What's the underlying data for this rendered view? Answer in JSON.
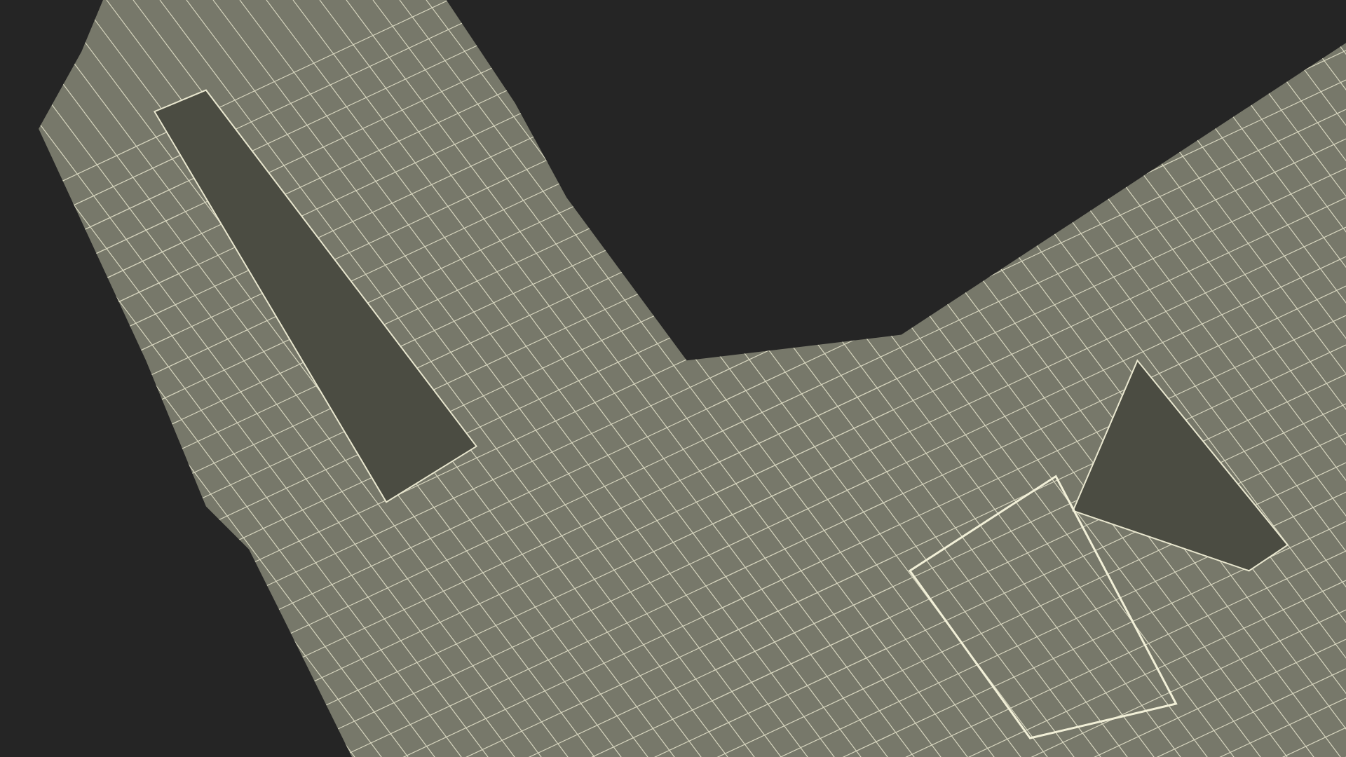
{
  "scene": {
    "kind": "wireframe-render"
  }
}
